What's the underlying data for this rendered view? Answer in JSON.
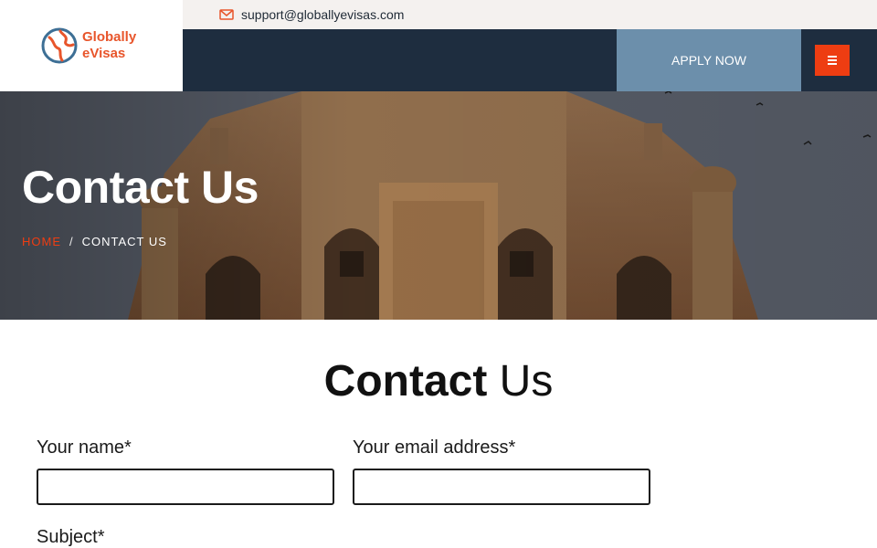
{
  "brand": {
    "line1": "Globally",
    "line2": "eVisas",
    "logo_icon": "globe-icon",
    "color": "#e8552b"
  },
  "topbar": {
    "email": "support@globallyevisas.com",
    "email_icon": "mail-icon"
  },
  "nav": {
    "apply_label": "APPLY NOW",
    "menu_icon": "hamburger-menu-icon",
    "accent": "#ee3d12"
  },
  "hero": {
    "title": "Contact Us",
    "breadcrumb": {
      "home": "HOME",
      "separator": "/",
      "current": "CONTACT US"
    }
  },
  "contact": {
    "title_bold": "Contact",
    "title_light": "Us",
    "fields": {
      "name_label": "Your name*",
      "name_value": "",
      "email_label": "Your email address*",
      "email_value": "",
      "subject_label": "Subject*"
    }
  }
}
